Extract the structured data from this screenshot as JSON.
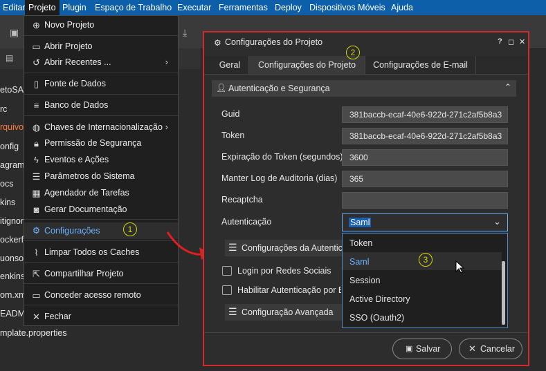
{
  "menubar": {
    "items": [
      "Editar",
      "Projeto",
      "Plugin",
      "Espaço de Trabalho",
      "Executar",
      "Ferramentas",
      "Deploy",
      "Dispositivos Móveis",
      "Ajuda"
    ]
  },
  "left_panel": {
    "items": [
      "etoSAM",
      "rc",
      "rquivos",
      "onfig",
      "agram",
      "ocs",
      "kins",
      "itignor",
      "ockerfi",
      "uonso",
      "enkinst",
      "om.xm",
      "EADM",
      "mplate.properties"
    ]
  },
  "project_menu": {
    "items": [
      {
        "label": "Novo Projeto",
        "icon": "new-project-icon"
      },
      {
        "label": "Abrir Projeto",
        "icon": "folder-icon"
      },
      {
        "label": "Abrir Recentes ...",
        "icon": "history-icon",
        "submenu": true
      },
      {
        "label": "Fonte de Dados",
        "icon": "datasource-icon"
      },
      {
        "label": "Banco de Dados",
        "icon": "database-icon"
      },
      {
        "label": "Chaves de Internacionalização",
        "icon": "globe-icon",
        "submenu": true
      },
      {
        "label": "Permissão de Segurança",
        "icon": "lock-icon"
      },
      {
        "label": "Eventos e Ações",
        "icon": "lightning-icon"
      },
      {
        "label": "Parâmetros do Sistema",
        "icon": "sliders-icon"
      },
      {
        "label": "Agendador de Tarefas",
        "icon": "calendar-icon"
      },
      {
        "label": "Gerar Documentação",
        "icon": "document-icon"
      },
      {
        "label": "Configurações",
        "icon": "gear-icon"
      },
      {
        "label": "Limpar Todos os Caches",
        "icon": "broom-icon"
      },
      {
        "label": "Compartilhar Projeto",
        "icon": "share-icon"
      },
      {
        "label": "Conceder acesso remoto",
        "icon": "monitor-icon"
      },
      {
        "label": "Fechar",
        "icon": "close-icon"
      }
    ]
  },
  "dialog": {
    "title": "Configurações do Projeto",
    "tabs": [
      "Geral",
      "Configurações do Projeto",
      "Configurações de E-mail"
    ],
    "section_title": "Autenticação e Segurança",
    "fields": {
      "guid": {
        "label": "Guid",
        "value": "381baccb-ecaf-40e6-922d-271c2af5b8a3"
      },
      "token": {
        "label": "Token",
        "value": "381baccb-ecaf-40e6-922d-271c2af5b8a3"
      },
      "token_expiration": {
        "label": "Expiração do Token (segundos)",
        "value": "3600"
      },
      "audit_log": {
        "label": "Manter Log de Auditoria (dias)",
        "value": "365"
      },
      "recaptcha": {
        "label": "Recaptcha",
        "value": ""
      },
      "authentication": {
        "label": "Autenticação",
        "value": "Saml"
      }
    },
    "auth_config_label": "Configurações da Autentica",
    "social_login_label": "Login por Redes Sociais",
    "enable_auth_label": "Habilitar Autenticação por Bi",
    "advanced_label": "Configuração Avançada",
    "auth_options": [
      "Token",
      "Saml",
      "Session",
      "Active Directory",
      "SSO (Oauth2)"
    ],
    "save_label": "Salvar",
    "cancel_label": "Cancelar"
  },
  "badges": [
    "1",
    "2",
    "3"
  ],
  "colors": {
    "menubar": "#0c5fa8",
    "highlight": "#d32b2b",
    "badge": "#d8d800",
    "selection": "#6ab0ff"
  }
}
